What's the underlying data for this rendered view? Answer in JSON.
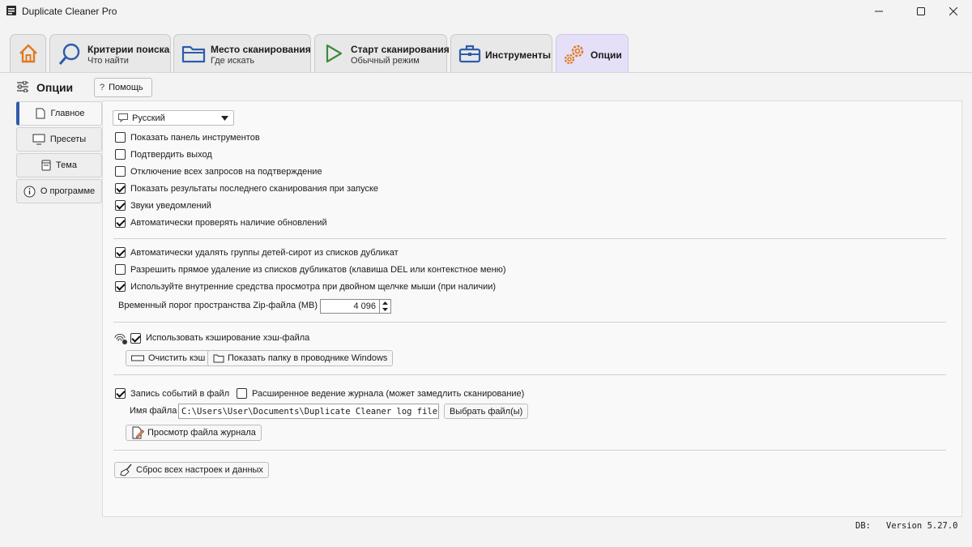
{
  "window": {
    "title": "Duplicate Cleaner Pro"
  },
  "tabs": [
    {
      "title": "Критерии поиска",
      "subtitle": "Что найти"
    },
    {
      "title": "Место сканирования",
      "subtitle": "Где искать"
    },
    {
      "title": "Старт сканирования",
      "subtitle": "Обычный режим"
    },
    {
      "title": "Инструменты"
    },
    {
      "title": "Опции"
    }
  ],
  "header": {
    "title": "Опции",
    "help_label": "Помощь"
  },
  "sidebar": {
    "items": [
      {
        "label": "Главное"
      },
      {
        "label": "Пресеты"
      },
      {
        "label": "Тема"
      },
      {
        "label": "О программе"
      }
    ]
  },
  "general": {
    "language": "Русский",
    "options": [
      {
        "label": "Показать панель инструментов",
        "checked": false
      },
      {
        "label": "Подтвердить выход",
        "checked": false
      },
      {
        "label": "Отключение всех запросов на подтверждение",
        "checked": false
      },
      {
        "label": "Показать результаты последнего сканирования при запуске",
        "checked": true
      },
      {
        "label": "Звуки уведомлений",
        "checked": true
      },
      {
        "label": "Автоматически проверять наличие обновлений",
        "checked": true
      }
    ]
  },
  "dup_lists": {
    "options": [
      {
        "label": "Автоматически удалять группы детей-сирот из списков дубликат",
        "checked": true
      },
      {
        "label": "Разрешить прямое удаление из списков дубликатов (клавиша DEL или контекстное меню)",
        "checked": false
      },
      {
        "label": "Используйте внутренние средства просмотра при двойном щелчке мыши (при наличии)",
        "checked": true
      }
    ],
    "zip_label": "Временный порог пространства Zip-файла (MB)",
    "zip_value": "4 096"
  },
  "cache": {
    "label": "Использовать кэширование хэш-файла",
    "checked": true,
    "clear_label": "Очистить кэш",
    "show_folder_label": "Показать папку в проводнике Windows"
  },
  "log": {
    "log_label": "Запись событий в файл",
    "log_checked": true,
    "extended_label": "Расширенное ведение журнала (может замедлить сканирование)",
    "extended_checked": false,
    "filename_label": "Имя файла",
    "filename_value": "C:\\Users\\User\\Documents\\Duplicate Cleaner log file.txt",
    "choose_label": "Выбрать файл(ы)",
    "view_label": "Просмотр файла журнала"
  },
  "reset_label": "Сброс всех настроек и данных",
  "status": {
    "db_label": "DB:",
    "version": "Version 5.27.0"
  },
  "colors": {
    "active_tab": "#e5e0f7",
    "accent": "#2e5cac"
  }
}
